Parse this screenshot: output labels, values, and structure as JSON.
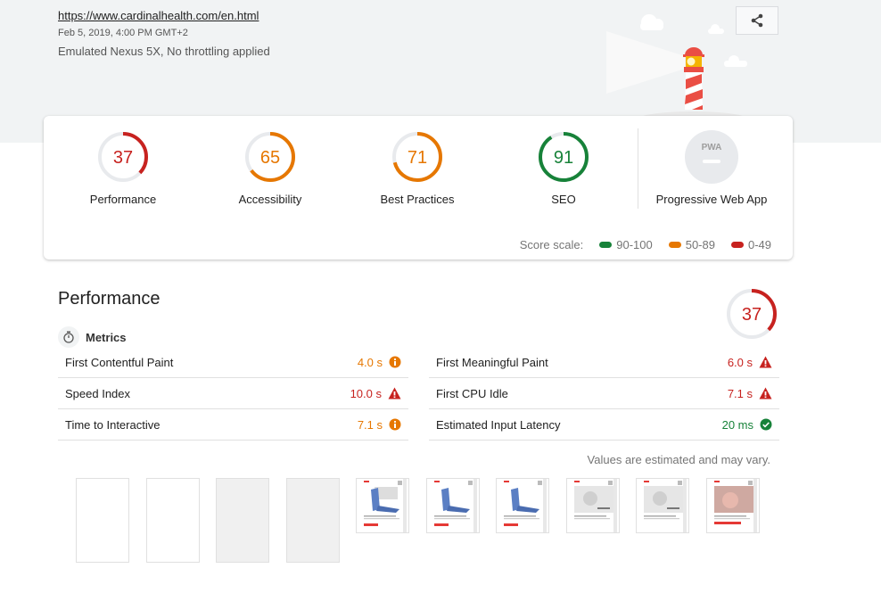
{
  "header": {
    "url": "https://www.cardinalhealth.com/en.html",
    "date": "Feb 5, 2019, 4:00 PM GMT+2",
    "device": "Emulated Nexus 5X, No throttling applied",
    "share_icon": "share-icon"
  },
  "categories": [
    {
      "label": "Performance",
      "score": "37",
      "value": 0.37,
      "color": "#c7221f"
    },
    {
      "label": "Accessibility",
      "score": "65",
      "value": 0.65,
      "color": "#e67700"
    },
    {
      "label": "Best Practices",
      "score": "71",
      "value": 0.71,
      "color": "#e67700"
    },
    {
      "label": "SEO",
      "score": "91",
      "value": 0.91,
      "color": "#178239"
    },
    {
      "label": "Progressive Web App",
      "badge": "PWA"
    }
  ],
  "score_scale": {
    "label": "Score scale:",
    "ranges": [
      {
        "label": "90-100",
        "color": "#178239"
      },
      {
        "label": "50-89",
        "color": "#e67700"
      },
      {
        "label": "0-49",
        "color": "#c7221f"
      }
    ]
  },
  "performance": {
    "title": "Performance",
    "score": "37",
    "value": 0.37,
    "metrics_label": "Metrics",
    "metrics_left": [
      {
        "name": "First Contentful Paint",
        "value": "4.0 s",
        "status": "average"
      },
      {
        "name": "Speed Index",
        "value": "10.0 s",
        "status": "fail"
      },
      {
        "name": "Time to Interactive",
        "value": "7.1 s",
        "status": "average"
      }
    ],
    "metrics_right": [
      {
        "name": "First Meaningful Paint",
        "value": "6.0 s",
        "status": "fail"
      },
      {
        "name": "First CPU Idle",
        "value": "7.1 s",
        "status": "fail"
      },
      {
        "name": "Estimated Input Latency",
        "value": "20 ms",
        "status": "pass"
      }
    ],
    "note": "Values are estimated and may vary."
  },
  "colors": {
    "pass": "#178239",
    "average": "#e67700",
    "fail": "#c7221f"
  }
}
